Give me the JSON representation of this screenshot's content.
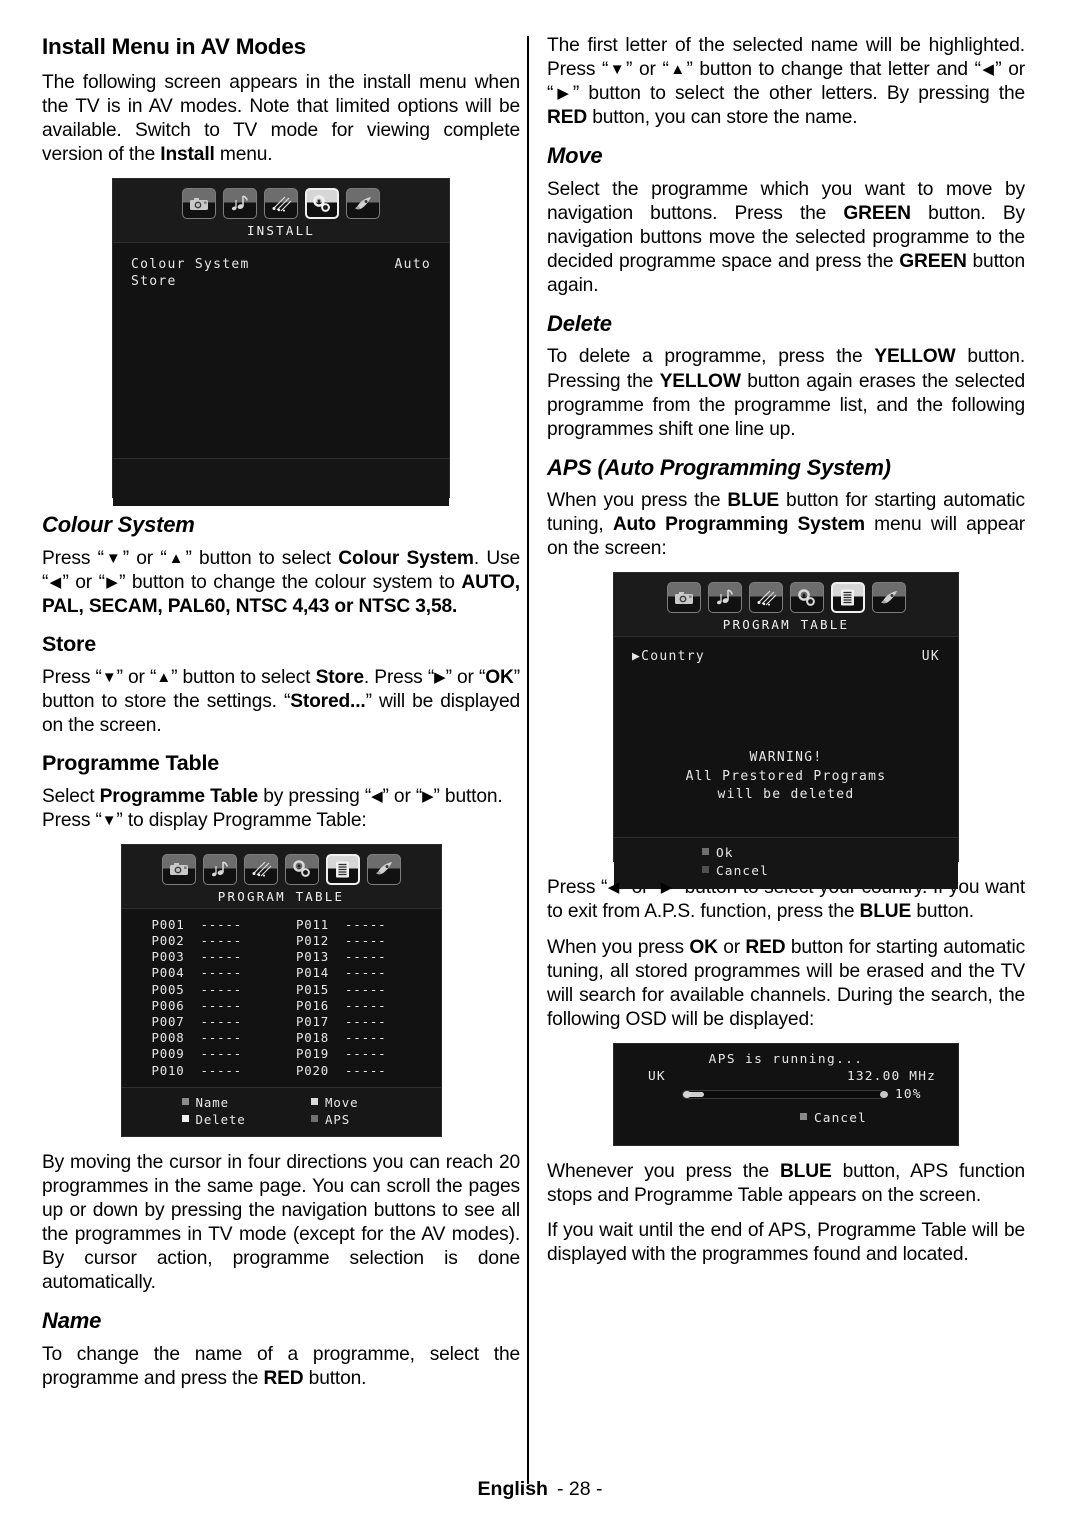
{
  "page": {
    "footer_language": "English",
    "footer_number": "- 28 -"
  },
  "left_column": {
    "heading": "Install Menu in AV Modes",
    "intro_p1_a": "The following screen appears in the install menu when the TV is in AV modes. Note that limited options will be available. Switch to TV mode for viewing complete version of the ",
    "intro_p1_b": "Install",
    "intro_p1_c": " menu.",
    "install_screen": {
      "title": "INSTALL",
      "icons": [
        "camera-icon",
        "music-note-icon",
        "comet-icon",
        "gears-icon",
        "rocket-icon"
      ],
      "selected_icon_index": 3,
      "rows": [
        {
          "label": "Colour System",
          "value": "Auto"
        },
        {
          "label": "Store",
          "value": ""
        }
      ]
    },
    "colour_system": {
      "heading": "Colour System",
      "p_a": "Press “",
      "p_down": "▼",
      "p_b": "” or “",
      "p_up": "▲",
      "p_c": "” button to select ",
      "p_bold1": "Colour System",
      "p_d": ". Use “",
      "p_left": "◀",
      "p_e": "” or “",
      "p_right": "▶",
      "p_f": "” button to change the colour system to ",
      "p_bold2": "AUTO, PAL, SECAM, PAL60, NTSC 4,43 or NTSC 3,58."
    },
    "store": {
      "heading": "Store",
      "p_a": "Press “",
      "p_b": "” or “",
      "p_c": "” button to select ",
      "p_bold1": "Store",
      "p_d": ". Press “",
      "p_e": "” or “",
      "p_bold2": "OK",
      "p_f": "” button to store the settings. “",
      "p_bold3": "Stored...",
      "p_g": "” will be displayed on the screen."
    },
    "programme_table": {
      "heading": "Programme Table",
      "p_a": "Select ",
      "p_bold1": "Programme Table",
      "p_b": " by pressing “",
      "p_c": "” or “",
      "p_d": "” button. Press “",
      "p_e": "” to display Programme Table:"
    },
    "program_table_screen": {
      "title": "PROGRAM TABLE",
      "icons": [
        "camera-icon",
        "music-note-icon",
        "comet-icon",
        "gears-icon",
        "list-icon",
        "rocket-icon"
      ],
      "selected_icon_index": 4,
      "dash": "-----",
      "column_left": [
        "P001",
        "P002",
        "P003",
        "P004",
        "P005",
        "P006",
        "P007",
        "P008",
        "P009",
        "P010"
      ],
      "column_right": [
        "P011",
        "P012",
        "P013",
        "P014",
        "P015",
        "P016",
        "P017",
        "P018",
        "P019",
        "P020"
      ],
      "footer_buttons": [
        {
          "label": "Name",
          "colour": "#8a8a8a"
        },
        {
          "label": "Move",
          "colour": "#d8d8d8"
        },
        {
          "label": "Delete",
          "colour": "#f0f0f0"
        },
        {
          "label": "APS",
          "colour": "#707070"
        }
      ]
    },
    "cursor_note": "By moving the cursor in four directions you can reach 20 programmes in the same page. You can scroll the pages up or down by pressing the navigation buttons to see all the programmes in TV mode (except for the AV modes). By cursor action, programme selection is done automatically.",
    "name": {
      "heading": "Name",
      "p_a": "To change the name of a programme, select the programme and press the ",
      "p_bold1": "RED",
      "p_b": " button."
    }
  },
  "right_column": {
    "name_cont": {
      "p_a": "The first letter of the selected name will be highlighted. Press “",
      "p_down": "▼",
      "p_b": "” or “",
      "p_up": "▲",
      "p_c": "” button to change that letter and “",
      "p_left": "◀",
      "p_d": "” or “",
      "p_right": "▶",
      "p_e": "” button to select the other letters.  By pressing the ",
      "p_bold1": "RED",
      "p_f": " button, you can store the name."
    },
    "move": {
      "heading": "Move",
      "p_a": "Select the programme which you want to move by navigation buttons. Press the ",
      "p_bold1": "GREEN",
      "p_b": " button. By navigation buttons move the selected programme to the decided programme space and press the ",
      "p_bold2": "GREEN",
      "p_c": " button again."
    },
    "delete": {
      "heading": "Delete",
      "p_a": "To delete a programme, press the ",
      "p_bold1": "YELLOW",
      "p_b": " button. Pressing the ",
      "p_bold2": "YELLOW",
      "p_c": " button again erases the selected programme from the programme list, and the following programmes shift one line up."
    },
    "aps": {
      "heading": "APS (Auto Programming System)",
      "p_a": "When you press the ",
      "p_bold1": "BLUE",
      "p_b": " button for starting automatic tuning, ",
      "p_bold2": "Auto Programming System",
      "p_c": " menu will appear on the screen:"
    },
    "aps_screen": {
      "title": "PROGRAM TABLE",
      "icons": [
        "camera-icon",
        "music-note-icon",
        "comet-icon",
        "gears-icon",
        "list-icon",
        "rocket-icon"
      ],
      "selected_icon_index": 4,
      "country_label": "Country",
      "country_value": "UK",
      "warning_line1": "WARNING!",
      "warning_line2": "All Prestored Programs",
      "warning_line3": "will be deleted",
      "footer_buttons": [
        {
          "label": "Ok",
          "colour": "#6f6f6f"
        },
        {
          "label": "Cancel",
          "colour": "#505050"
        }
      ]
    },
    "country_note": {
      "p_a": "Press “",
      "p_left": "◀",
      "p_b": "” or “",
      "p_right": "▶",
      "p_c": "” button to select your country. If you want to exit from A.P.S. function, press the ",
      "p_bold1": "BLUE",
      "p_d": " button."
    },
    "tuning_note": {
      "p_a": "When you press ",
      "p_bold1": "OK",
      "p_b": " or ",
      "p_bold2": "RED",
      "p_c": " button for starting automatic tuning, all stored programmes will be erased and the TV will search for available channels. During the search, the following OSD will be displayed:"
    },
    "running_screen": {
      "title": "APS is running...",
      "country": "UK",
      "frequency": "132.00 MHz",
      "percent": "10%",
      "progress_value": 10,
      "cancel_label": "Cancel",
      "cancel_colour": "#8a8a8a"
    },
    "blue_note": {
      "p_a": "Whenever you press the ",
      "p_bold1": "BLUE",
      "p_b": " button, APS  function stops and Programme Table appears on the screen."
    },
    "wait_note": "If you wait until the end of  APS, Programme Table will be displayed with the programmes found and located."
  }
}
